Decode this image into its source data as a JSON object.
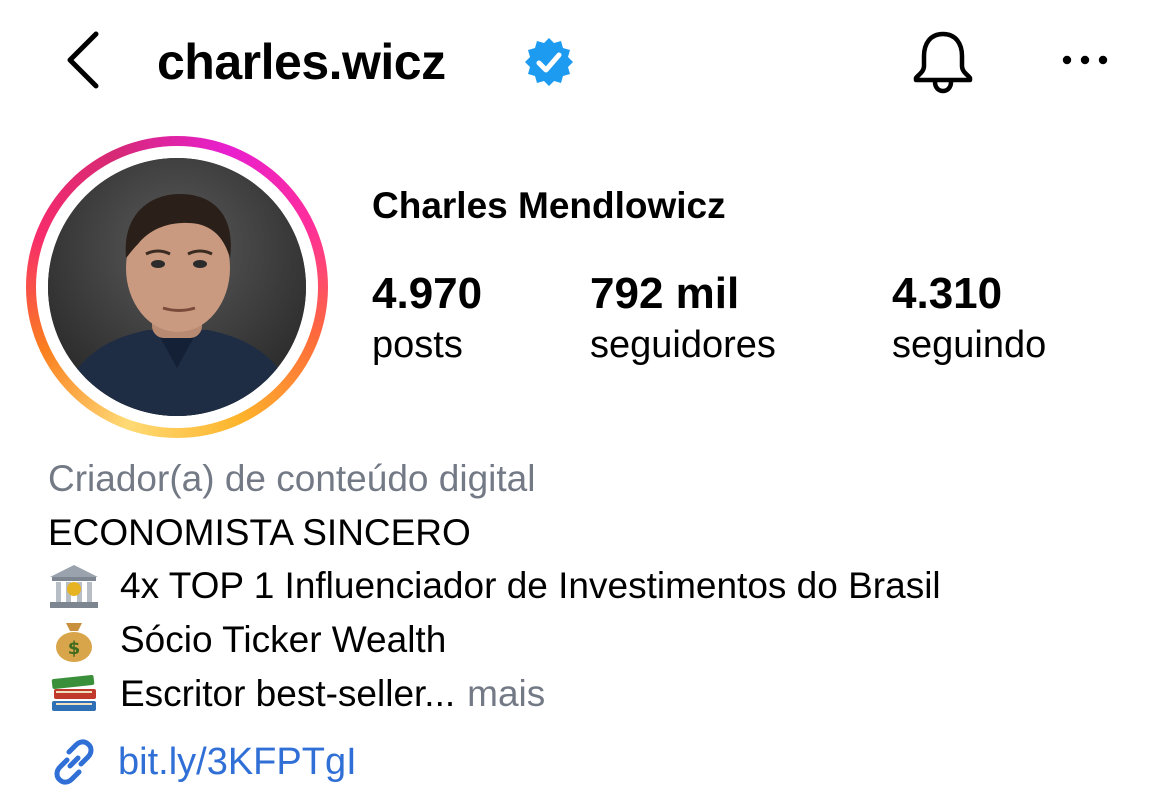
{
  "header": {
    "username": "charles.wicz",
    "verified_icon": "verified-badge-icon",
    "back_icon": "chevron-left-icon",
    "bell_icon": "bell-icon",
    "more_icon": "more-horizontal-icon"
  },
  "profile": {
    "full_name": "Charles Mendlowicz",
    "stats": [
      {
        "value": "4.970",
        "label": "posts"
      },
      {
        "value": "792 mil",
        "label": "seguidores"
      },
      {
        "value": "4.310",
        "label": "seguindo"
      }
    ]
  },
  "bio": {
    "category": "Criador(a) de conteúdo digital",
    "line1": "ECONOMISTA SINCERO",
    "line2": "4x TOP 1 Influenciador de Investimentos do Brasil",
    "line3": "Sócio Ticker Wealth",
    "line4": "Escritor best-seller...",
    "more_label": "mais",
    "link": "bit.ly/3KFPTgI"
  },
  "colors": {
    "verified": "#1d9bf0",
    "muted_text": "#737a86",
    "link": "#2f6fd6"
  }
}
